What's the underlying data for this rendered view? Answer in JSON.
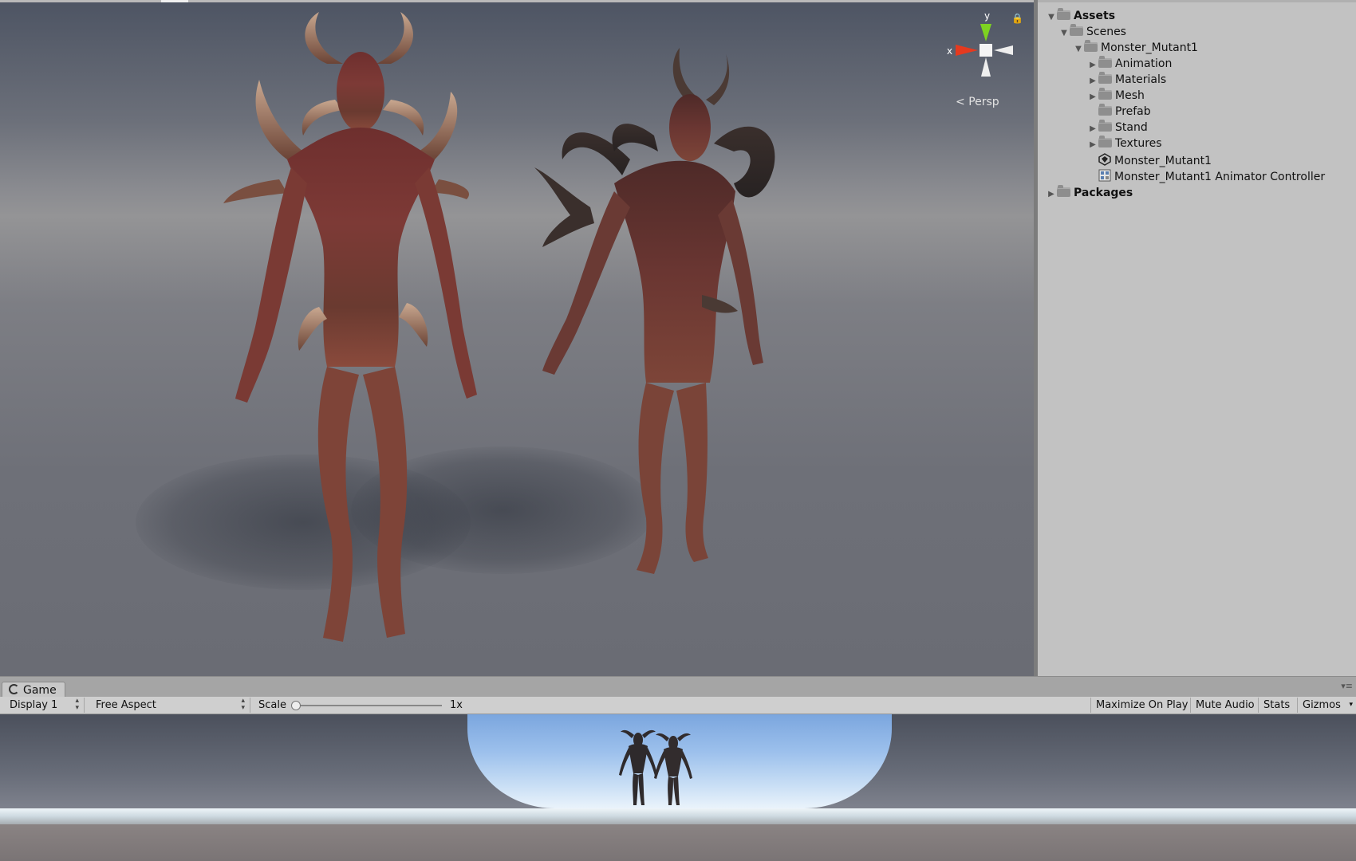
{
  "scene_view": {
    "gizmo": {
      "y_label": "y",
      "x_label": "x"
    },
    "projection_label": "Persp"
  },
  "project": {
    "items": [
      {
        "label": "Assets",
        "type": "folder",
        "depth": 0,
        "expanded": true,
        "bold": true
      },
      {
        "label": "Scenes",
        "type": "folder",
        "depth": 1,
        "expanded": true
      },
      {
        "label": "Monster_Mutant1",
        "type": "folder",
        "depth": 2,
        "expanded": true
      },
      {
        "label": "Animation",
        "type": "folder",
        "depth": 3,
        "expanded": false
      },
      {
        "label": "Materials",
        "type": "folder",
        "depth": 3,
        "expanded": false
      },
      {
        "label": "Mesh",
        "type": "folder",
        "depth": 3,
        "expanded": false
      },
      {
        "label": "Prefab",
        "type": "folder",
        "depth": 3
      },
      {
        "label": "Stand",
        "type": "folder",
        "depth": 3,
        "expanded": false
      },
      {
        "label": "Textures",
        "type": "folder",
        "depth": 3,
        "expanded": false
      },
      {
        "label": "Monster_Mutant1",
        "type": "unity-scene",
        "depth": 3
      },
      {
        "label": "Monster_Mutant1 Animator Controller",
        "type": "animator-controller",
        "depth": 3
      },
      {
        "label": "Packages",
        "type": "folder",
        "depth": 0,
        "expanded": false,
        "bold": true
      }
    ]
  },
  "game": {
    "tab_label": "Game",
    "display": "Display 1",
    "aspect": "Free Aspect",
    "scale_label": "Scale",
    "scale_value": "1x",
    "scale_level": 0,
    "maximize_on_play": "Maximize On Play",
    "mute_audio": "Mute Audio",
    "stats": "Stats",
    "gizmos": "Gizmos"
  }
}
